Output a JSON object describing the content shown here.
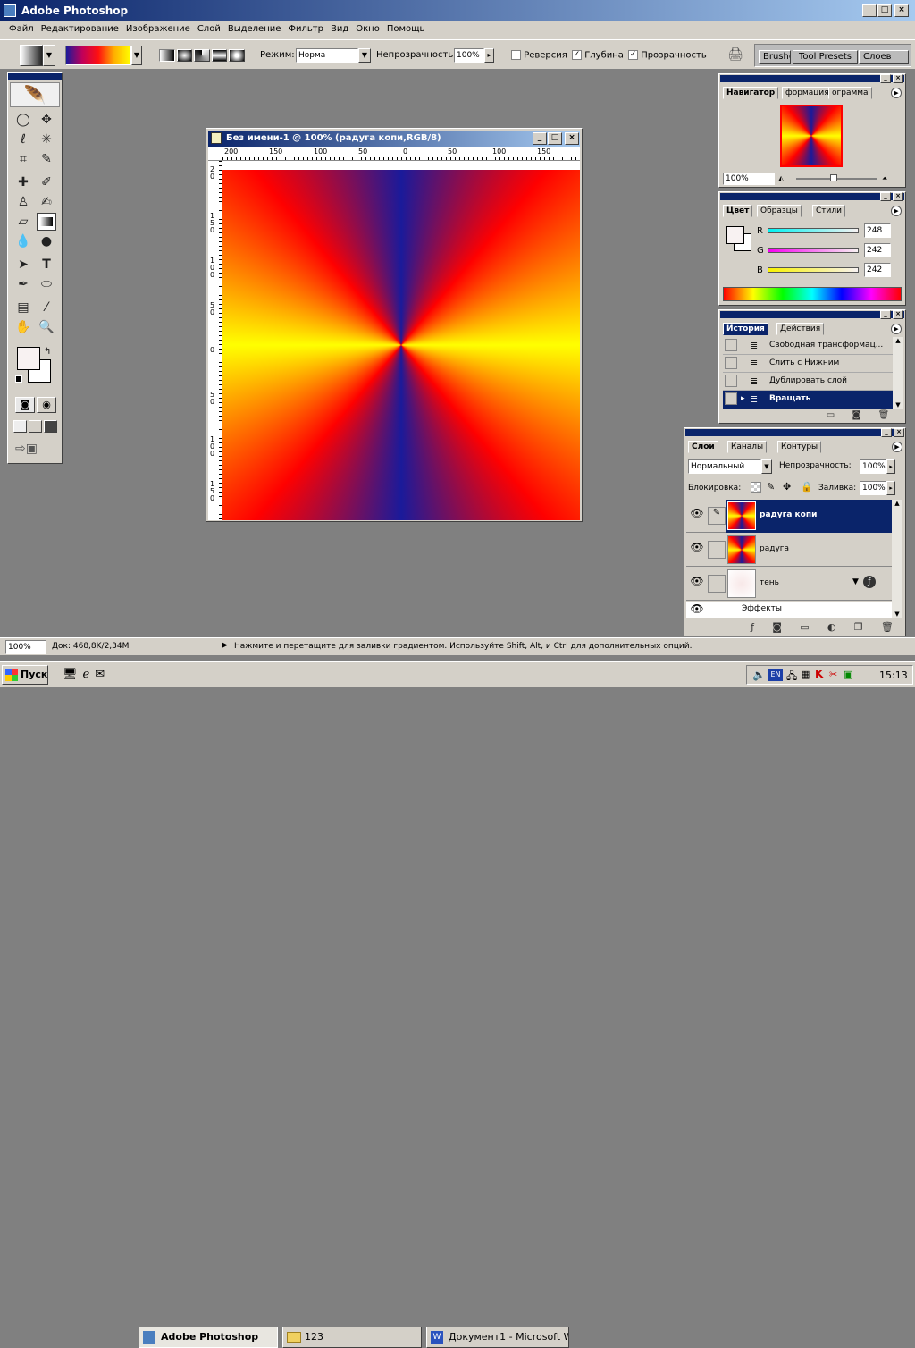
{
  "app": {
    "title": "Adobe Photoshop"
  },
  "menu": [
    "Файл",
    "Редактирование",
    "Изображение",
    "Слой",
    "Выделение",
    "Фильтр",
    "Вид",
    "Окно",
    "Помощь"
  ],
  "options": {
    "mode_label": "Режим:",
    "mode_value": "Норма",
    "opacity_label": "Непрозрачность:",
    "opacity_value": "100%",
    "reverse_label": "Реверсия",
    "dither_label": "Глубина",
    "transparency_label": "Прозрачность",
    "reverse_checked": false,
    "dither_checked": true,
    "transparency_checked": true
  },
  "palette_well": {
    "tabs": [
      "Brushes",
      "Tool Presets",
      "Слоев"
    ]
  },
  "document": {
    "title": "Без имени-1 @ 100% (радуга копи,RGB/8)",
    "ruler_h": [
      "200",
      "150",
      "100",
      "50",
      "0",
      "50",
      "100",
      "150"
    ],
    "ruler_v": [
      "2 0",
      "1 5 0",
      "1 0 0",
      "5 0",
      "0",
      "5 0",
      "1 0 0",
      "1 5 0"
    ]
  },
  "navigator": {
    "tabs": [
      "Навигатор",
      "формация",
      "ограмма"
    ],
    "zoom": "100%"
  },
  "color": {
    "tabs": [
      "Цвет",
      "Образцы",
      "Стили"
    ],
    "r_label": "R",
    "g_label": "G",
    "b_label": "B",
    "r": "248",
    "g": "242",
    "b": "242"
  },
  "history": {
    "tabs": [
      "История",
      "Действия"
    ],
    "items": [
      "Свободная трансформац...",
      "Слить с Нижним",
      "Дублировать слой",
      "Вращать"
    ]
  },
  "layers": {
    "tabs": [
      "Слои",
      "Каналы",
      "Контуры"
    ],
    "blend": "Нормальный",
    "opacity_label": "Непрозрачность:",
    "opacity": "100%",
    "lock_label": "Блокировка:",
    "fill_label": "Заливка:",
    "fill": "100%",
    "items": [
      "радуга копи",
      "радуга",
      "тень"
    ],
    "effects": "Эффекты"
  },
  "status": {
    "zoom": "100%",
    "doc": "Док: 468,8K/2,34M",
    "hint": "Нажмите и перетащите для заливки градиентом. Используйте Shift, Alt, и Ctrl для дополнительных опций."
  },
  "taskbar": {
    "start": "Пуск",
    "tasks": [
      "Adobe Photoshop",
      "123",
      "Документ1 - Microsoft W..."
    ],
    "lang": "EN",
    "clock": "15:13"
  }
}
